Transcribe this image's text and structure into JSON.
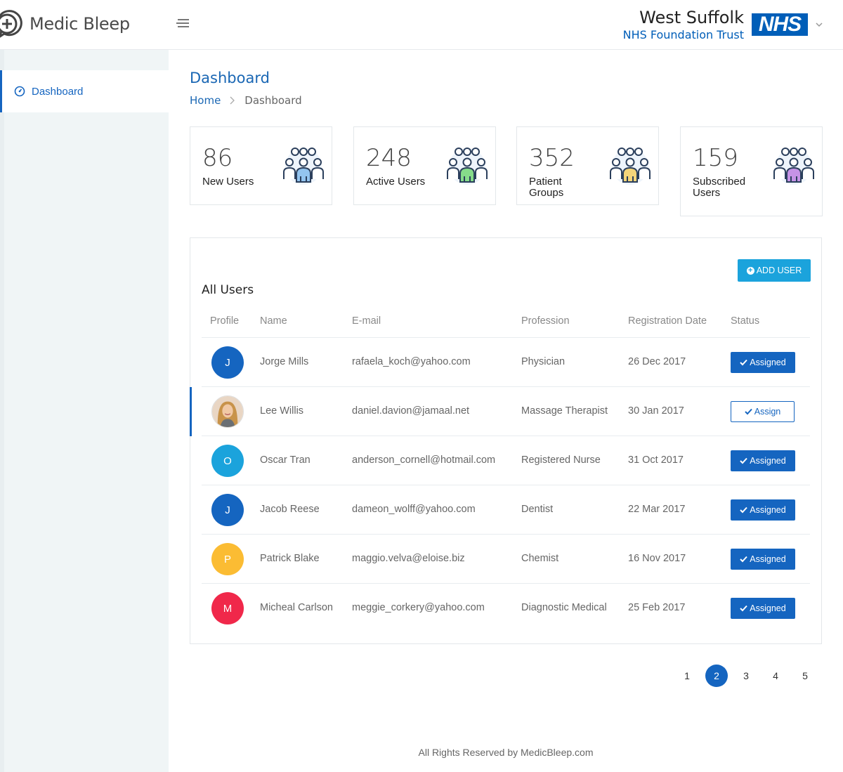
{
  "app": {
    "name": "Medic Bleep",
    "trust_name": "West Suffolk",
    "trust_sub": "NHS Foundation Trust",
    "nhs_logo_text": "NHS"
  },
  "sidebar": {
    "items": [
      {
        "label": "Dashboard",
        "icon": "dashboard-icon",
        "active": true
      }
    ]
  },
  "page": {
    "title": "Dashboard",
    "breadcrumb": {
      "home": "Home",
      "current": "Dashboard"
    }
  },
  "stats": [
    {
      "value": "86",
      "label": "New Users",
      "color": "#93c4ef"
    },
    {
      "value": "248",
      "label": "Active Users",
      "color": "#86dc8a"
    },
    {
      "value": "352",
      "label": "Patient Groups",
      "color": "#f5d57a"
    },
    {
      "value": "159",
      "label": "Subscribed Users",
      "color": "#c593e6"
    }
  ],
  "users_panel": {
    "title": "All Users",
    "add_button": "ADD USER",
    "columns": [
      "Profile",
      "Name",
      "E-mail",
      "Profession",
      "Registration Date",
      "Status"
    ],
    "rows": [
      {
        "initial": "J",
        "avatar_color": "#1565c0",
        "name": "Jorge Mills",
        "email": "rafaela_koch@yahoo.com",
        "profession": "Physician",
        "date": "26 Dec 2017",
        "status": "Assigned"
      },
      {
        "initial": "",
        "avatar_color": "photo",
        "name": "Lee Willis",
        "email": "daniel.davion@jamaal.net",
        "profession": "Massage Therapist",
        "date": "30 Jan 2017",
        "status": "Assign"
      },
      {
        "initial": "O",
        "avatar_color": "#1ba3dc",
        "name": "Oscar Tran",
        "email": "anderson_cornell@hotmail.com",
        "profession": "Registered Nurse",
        "date": "31 Oct 2017",
        "status": "Assigned"
      },
      {
        "initial": "J",
        "avatar_color": "#1565c0",
        "name": "Jacob Reese",
        "email": "dameon_wolff@yahoo.com",
        "profession": "Dentist",
        "date": "22 Mar 2017",
        "status": "Assigned"
      },
      {
        "initial": "P",
        "avatar_color": "#fbbc33",
        "name": "Patrick Blake",
        "email": "maggio.velva@eloise.biz",
        "profession": "Chemist",
        "date": "16 Nov 2017",
        "status": "Assigned"
      },
      {
        "initial": "M",
        "avatar_color": "#f0284a",
        "name": "Micheal Carlson",
        "email": "meggie_corkery@yahoo.com",
        "profession": "Diagnostic Medical",
        "date": "25 Feb 2017",
        "status": "Assigned"
      }
    ]
  },
  "pagination": {
    "pages": [
      "1",
      "2",
      "3",
      "4",
      "5"
    ],
    "current": "2"
  },
  "footer": "All Rights Reserved by MedicBleep.com"
}
